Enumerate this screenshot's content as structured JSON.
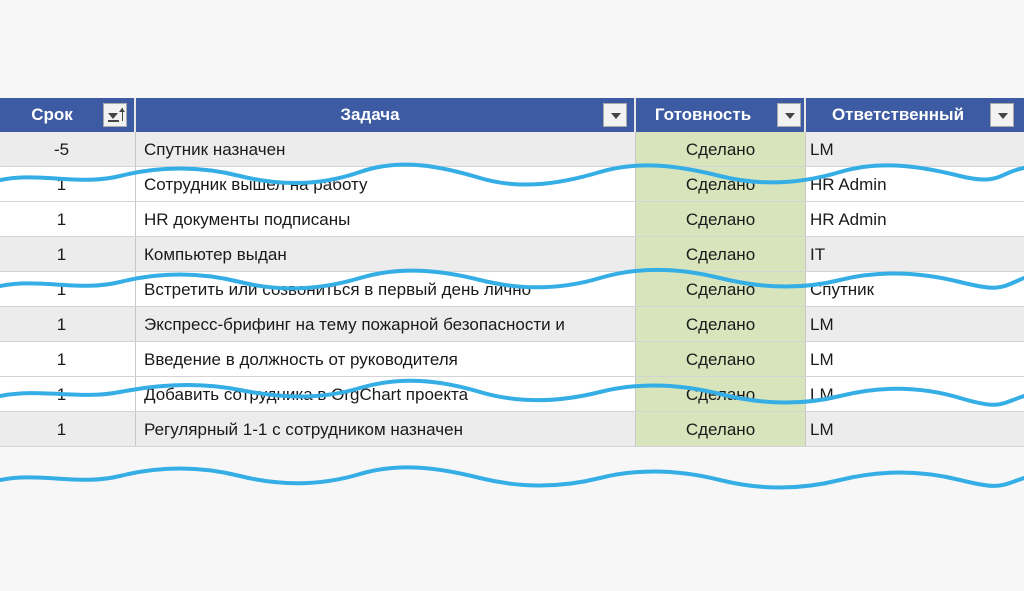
{
  "columns": {
    "srok": "Срок",
    "zadacha": "Задача",
    "gotovnost": "Готовность",
    "otvetstvenny": "Ответственный"
  },
  "rows": [
    {
      "srok": "-5",
      "zadacha": "Спутник назначен",
      "gotovnost": "Сделано",
      "otvetstvenny": "LM"
    },
    {
      "srok": "1",
      "zadacha": "Сотрудник вышел на работу",
      "gotovnost": "Сделано",
      "otvetstvenny": "HR Admin"
    },
    {
      "srok": "1",
      "zadacha": "HR документы подписаны",
      "gotovnost": "Сделано",
      "otvetstvenny": "HR Admin"
    },
    {
      "srok": "1",
      "zadacha": "Компьютер выдан",
      "gotovnost": "Сделано",
      "otvetstvenny": "IT"
    },
    {
      "srok": "1",
      "zadacha": "Встретить или созвониться в первый день лично",
      "gotovnost": "Сделано",
      "otvetstvenny": "Спутник"
    },
    {
      "srok": "1",
      "zadacha": "Экспресс-брифинг на тему пожарной безопасности и",
      "gotovnost": "Сделано",
      "otvetstvenny": "LM"
    },
    {
      "srok": "1",
      "zadacha": "Введение в должность от руководителя",
      "gotovnost": "Сделано",
      "otvetstvenny": "LM"
    },
    {
      "srok": "1",
      "zadacha": "Добавить сотрудника в OrgChart проекта",
      "gotovnost": "Сделано",
      "otvetstvenny": "LM"
    },
    {
      "srok": "1",
      "zadacha": "Регулярный 1-1 с сотрудником назначен",
      "gotovnost": "Сделано",
      "otvetstvenny": "LM"
    }
  ],
  "colors": {
    "header_bg": "#3c5ba3",
    "done_bg": "#d8e4bc",
    "squiggle": "#35aee6"
  },
  "icons": {
    "sort_filter": "sort-ascending-filter-icon",
    "filter": "filter-dropdown-icon"
  }
}
